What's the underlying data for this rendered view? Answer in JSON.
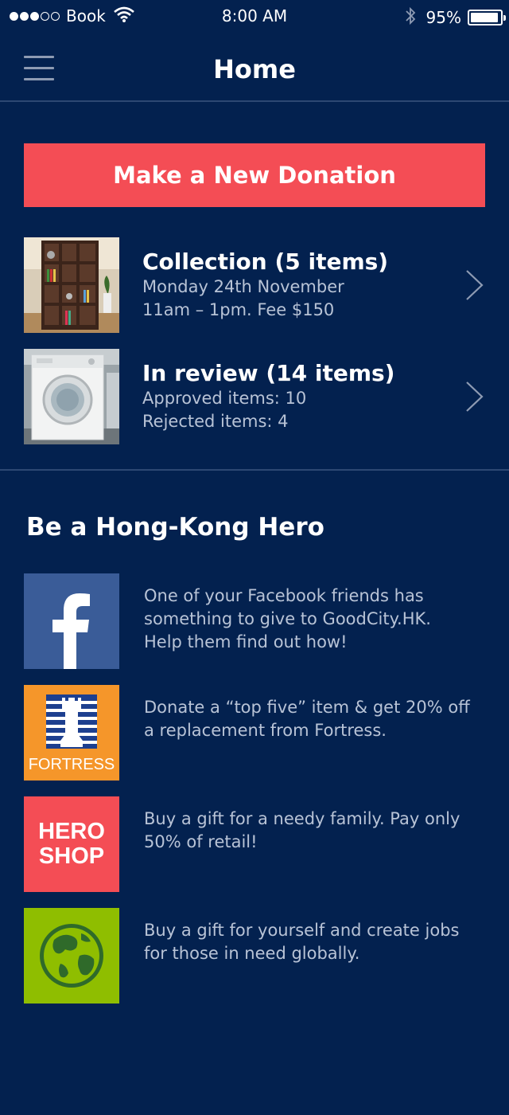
{
  "status_bar": {
    "signal_filled": 3,
    "signal_total": 5,
    "carrier": "Book",
    "time": "8:00 AM",
    "battery_percent_text": "95%",
    "battery_level": 0.95,
    "icons": [
      "wifi-icon",
      "bluetooth-icon",
      "battery-icon"
    ]
  },
  "nav": {
    "title": "Home",
    "menu_icon": "hamburger-menu-icon"
  },
  "donate_button": {
    "label": "Make a New Donation"
  },
  "donations": [
    {
      "title": "Collection (5 items)",
      "lines": [
        "Monday 24th November",
        "11am – 1pm. Fee $150"
      ],
      "thumbnail": "bookshelf-photo"
    },
    {
      "title": "In review (14 items)",
      "lines": [
        "Approved items: 10",
        "Rejected items: 4"
      ],
      "thumbnail": "washing-machine-photo"
    }
  ],
  "hero_section": {
    "title": "Be a Hong-Kong Hero",
    "items": [
      {
        "icon": "facebook-icon",
        "text_lines": [
          "One of your Facebook friends has",
          "something to give to GoodCity.HK.",
          "Help them find out how!"
        ]
      },
      {
        "icon": "fortress-logo",
        "logo_text": "FORTRESS",
        "text_lines": [
          "Donate a “top five” item & get 20% off",
          "a replacement from Fortress."
        ]
      },
      {
        "icon": "hero-shop-logo",
        "logo_lines": [
          "HERO",
          "SHOP"
        ],
        "text_lines": [
          "Buy a gift for a needy family. Pay only",
          "50% of retail!"
        ]
      },
      {
        "icon": "globe-icon",
        "text_lines": [
          "Buy a gift for yourself and create jobs",
          "for those in need globally."
        ]
      }
    ]
  },
  "colors": {
    "background": "#03214f",
    "accent": "#f44d55",
    "divider": "#2d4873",
    "secondary_text": "#b8c3d6",
    "facebook": "#3a5c98",
    "fortress": "#f5962a",
    "globe": "#8fbe00"
  }
}
